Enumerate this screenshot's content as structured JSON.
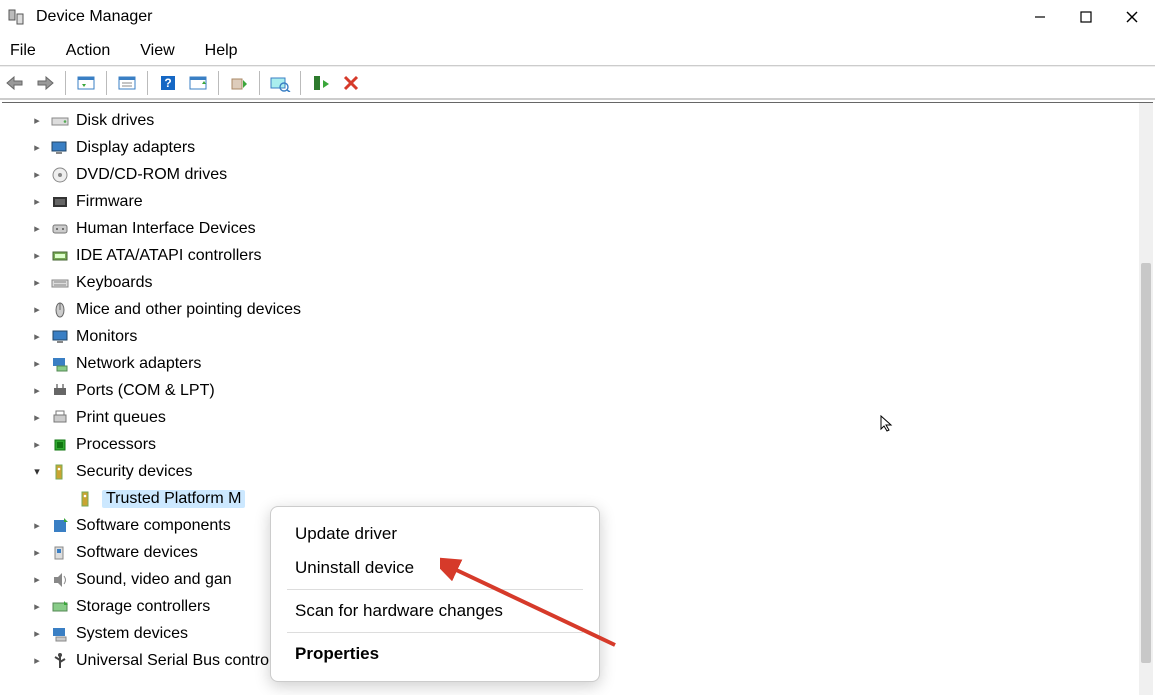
{
  "window": {
    "title": "Device Manager"
  },
  "menu": {
    "file": "File",
    "action": "Action",
    "view": "View",
    "help": "Help"
  },
  "tree": {
    "items": [
      {
        "label": "Disk drives",
        "icon": "drive"
      },
      {
        "label": "Display adapters",
        "icon": "display"
      },
      {
        "label": "DVD/CD-ROM drives",
        "icon": "optical"
      },
      {
        "label": "Firmware",
        "icon": "firmware"
      },
      {
        "label": "Human Interface Devices",
        "icon": "hid"
      },
      {
        "label": "IDE ATA/ATAPI controllers",
        "icon": "ide"
      },
      {
        "label": "Keyboards",
        "icon": "keyboard"
      },
      {
        "label": "Mice and other pointing devices",
        "icon": "mouse"
      },
      {
        "label": "Monitors",
        "icon": "monitor"
      },
      {
        "label": "Network adapters",
        "icon": "network"
      },
      {
        "label": "Ports (COM & LPT)",
        "icon": "port"
      },
      {
        "label": "Print queues",
        "icon": "printer"
      },
      {
        "label": "Processors",
        "icon": "cpu"
      },
      {
        "label": "Security devices",
        "icon": "security",
        "expanded": true,
        "children": [
          {
            "label": "Trusted Platform M",
            "icon": "tpm",
            "selected": true
          }
        ]
      },
      {
        "label": "Software components",
        "icon": "swcomp"
      },
      {
        "label": "Software devices",
        "icon": "swdev"
      },
      {
        "label": "Sound, video and gan",
        "icon": "sound"
      },
      {
        "label": "Storage controllers",
        "icon": "storage"
      },
      {
        "label": "System devices",
        "icon": "system"
      },
      {
        "label": "Universal Serial Bus controllers",
        "icon": "usb"
      }
    ]
  },
  "context_menu": {
    "update_driver": "Update driver",
    "uninstall_device": "Uninstall device",
    "scan_hardware": "Scan for hardware changes",
    "properties": "Properties"
  },
  "icon_colors": {
    "blue": "#3a7fc4",
    "green": "#3aa63a",
    "gray": "#888888",
    "dark": "#444444",
    "red": "#d63a2a",
    "yellow": "#d6a20a"
  }
}
